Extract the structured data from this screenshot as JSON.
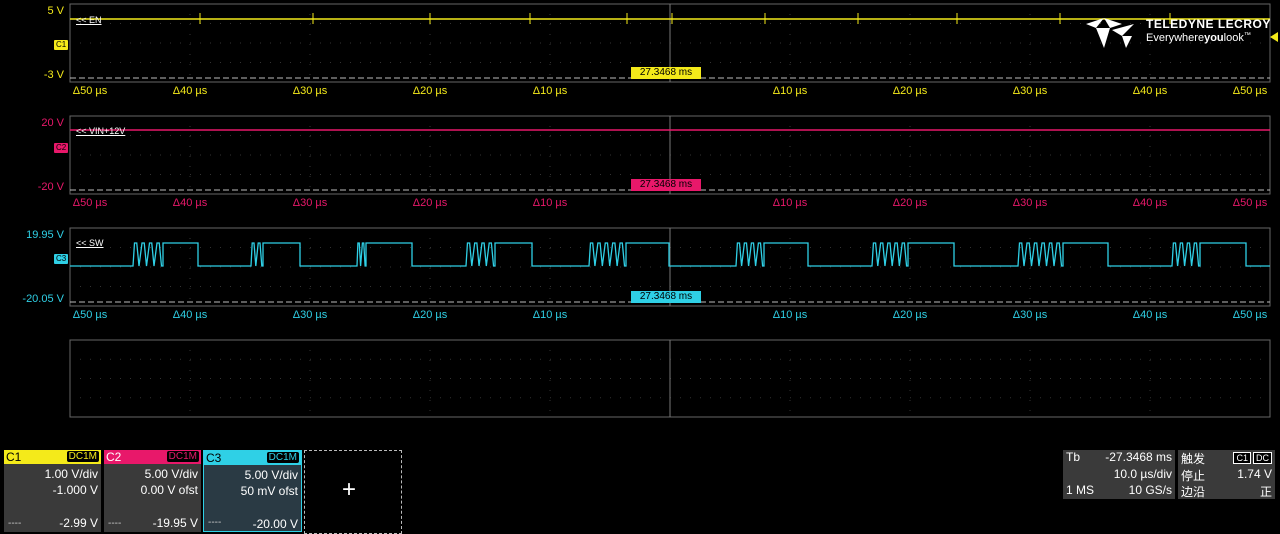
{
  "colors": {
    "c1": "#f4ea1a",
    "c2": "#e8186a",
    "c3": "#2fd0e6",
    "grid": "#666666"
  },
  "logo": {
    "brand": "TELEDYNE LECROY",
    "tag_pre": "Everywhere",
    "tag_bold": "you",
    "tag_post": "look",
    "tm": "™",
    "icon": "teledyne-logo-icon"
  },
  "traces": [
    {
      "id": "C1",
      "label": "<< EN",
      "top_v": "5 V",
      "bot_v": "-3 V",
      "time": "27.3468 ms"
    },
    {
      "id": "C2",
      "label": "<< VIN+12V",
      "top_v": "20 V",
      "bot_v": "-20 V",
      "time": "27.3468 ms"
    },
    {
      "id": "C3",
      "label": "<< SW",
      "top_v": "19.95 V",
      "bot_v": "-20.05 V",
      "time": "27.3468 ms"
    }
  ],
  "ticks": [
    "Δ50 µs",
    "Δ40 µs",
    "Δ30 µs",
    "Δ20 µs",
    "Δ10 µs",
    "",
    "Δ10 µs",
    "Δ20 µs",
    "Δ30 µs",
    "Δ40 µs",
    "Δ50 µs"
  ],
  "channels": [
    {
      "name": "C1",
      "coupling": "DC1M",
      "vdiv": "1.00 V/div",
      "offset": "-1.000 V",
      "dash": "----",
      "level": "-2.99 V"
    },
    {
      "name": "C2",
      "coupling": "DC1M",
      "vdiv": "5.00 V/div",
      "offset": "0.00 V ofst",
      "dash": "----",
      "level": "-19.95 V"
    },
    {
      "name": "C3",
      "coupling": "DC1M",
      "vdiv": "5.00 V/div",
      "offset": "50 mV ofst",
      "dash": "----",
      "level": "-20.00 V"
    }
  ],
  "add_channel": "+",
  "timebase": {
    "label": "Tb",
    "delay": "-27.3468 ms",
    "tdiv": "10.0 µs/div",
    "mem": "1 MS",
    "rate": "10 GS/s"
  },
  "trigger": {
    "label": "触发",
    "src": "C1",
    "coupling": "DC",
    "mode": "停止",
    "level": "1.74 V",
    "slope_label": "边沿",
    "slope": "正"
  }
}
